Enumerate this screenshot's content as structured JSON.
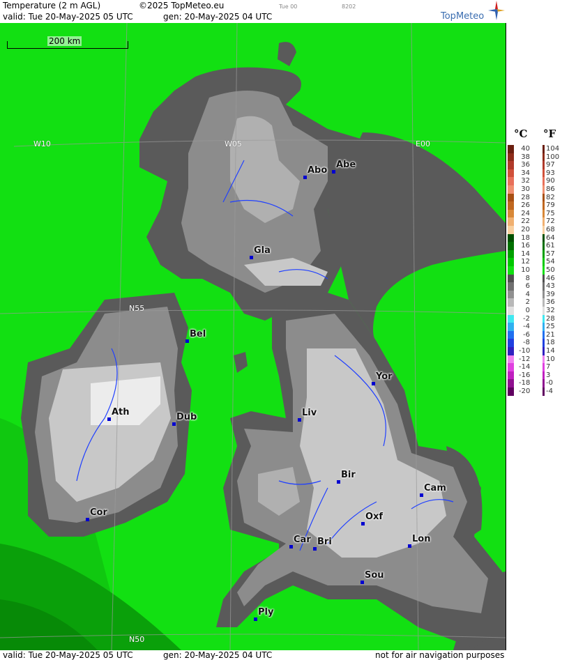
{
  "header": {
    "title": "Temperature (2 m AGL)",
    "copyright": "©2025 TopMeteo.eu",
    "run": "Tue 00",
    "code": "8202",
    "valid": "valid:  Tue  20-May-2025  05 UTC",
    "gen": "gen: 20-May-2025 04 UTC",
    "logo": "TopMeteo"
  },
  "map": {
    "scale_label": "200 km",
    "grid_labels": [
      "W10",
      "W05",
      "E00",
      "N55",
      "N50"
    ],
    "cities": [
      {
        "name": "Abo"
      },
      {
        "name": "Abe"
      },
      {
        "name": "Gla"
      },
      {
        "name": "Bel"
      },
      {
        "name": "Yor"
      },
      {
        "name": "Ath"
      },
      {
        "name": "Dub"
      },
      {
        "name": "Liv"
      },
      {
        "name": "Bir"
      },
      {
        "name": "Cam"
      },
      {
        "name": "Cor"
      },
      {
        "name": "Oxf"
      },
      {
        "name": "Car"
      },
      {
        "name": "Bri"
      },
      {
        "name": "Lon"
      },
      {
        "name": "Sou"
      },
      {
        "name": "Ply"
      }
    ],
    "colors": {
      "sea": "#12e012",
      "land_dark": "#5a5a5a",
      "land_mid": "#8c8c8c",
      "land_light": "#c8c8c8",
      "city": "#0000d0",
      "river": "#2040ff"
    }
  },
  "legend": {
    "unit_c": "°C",
    "unit_f": "°F",
    "rows": [
      {
        "c": "40",
        "f": "104",
        "color": "#6b1f10"
      },
      {
        "c": "38",
        "f": "100",
        "color": "#8e2c1a"
      },
      {
        "c": "36",
        "f": "97",
        "color": "#b03a2a"
      },
      {
        "c": "34",
        "f": "93",
        "color": "#d0503a"
      },
      {
        "c": "32",
        "f": "90",
        "color": "#e8705a"
      },
      {
        "c": "30",
        "f": "86",
        "color": "#f09070"
      },
      {
        "c": "28",
        "f": "82",
        "color": "#a85014"
      },
      {
        "c": "26",
        "f": "79",
        "color": "#c06820"
      },
      {
        "c": "24",
        "f": "75",
        "color": "#d88838"
      },
      {
        "c": "22",
        "f": "72",
        "color": "#f0b070"
      },
      {
        "c": "20",
        "f": "68",
        "color": "#f8d0a0"
      },
      {
        "c": "18",
        "f": "64",
        "color": "#005000"
      },
      {
        "c": "16",
        "f": "61",
        "color": "#007000"
      },
      {
        "c": "14",
        "f": "57",
        "color": "#00a000"
      },
      {
        "c": "12",
        "f": "54",
        "color": "#00c800"
      },
      {
        "c": "10",
        "f": "50",
        "color": "#12e012"
      },
      {
        "c": "8",
        "f": "46",
        "color": "#505050"
      },
      {
        "c": "6",
        "f": "43",
        "color": "#707070"
      },
      {
        "c": "4",
        "f": "39",
        "color": "#909090"
      },
      {
        "c": "2",
        "f": "36",
        "color": "#b8b8b8"
      },
      {
        "c": "0",
        "f": "32",
        "color": "#e0e0e0"
      },
      {
        "c": "-2",
        "f": "28",
        "color": "#40e8f0"
      },
      {
        "c": "-4",
        "f": "25",
        "color": "#30b0f0"
      },
      {
        "c": "-6",
        "f": "21",
        "color": "#2070f0"
      },
      {
        "c": "-8",
        "f": "18",
        "color": "#2040e0"
      },
      {
        "c": "-10",
        "f": "14",
        "color": "#3020c0"
      },
      {
        "c": "-12",
        "f": "10",
        "color": "#f080f0"
      },
      {
        "c": "-14",
        "f": "7",
        "color": "#e040e0"
      },
      {
        "c": "-16",
        "f": "3",
        "color": "#c020c0"
      },
      {
        "c": "-18",
        "f": "-0",
        "color": "#901090"
      },
      {
        "c": "-20",
        "f": "-4",
        "color": "#600060"
      }
    ]
  },
  "footer": {
    "valid": "valid:  Tue  20-May-2025  05 UTC",
    "gen": "gen: 20-May-2025 04 UTC",
    "note": "not for air navigation purposes"
  }
}
